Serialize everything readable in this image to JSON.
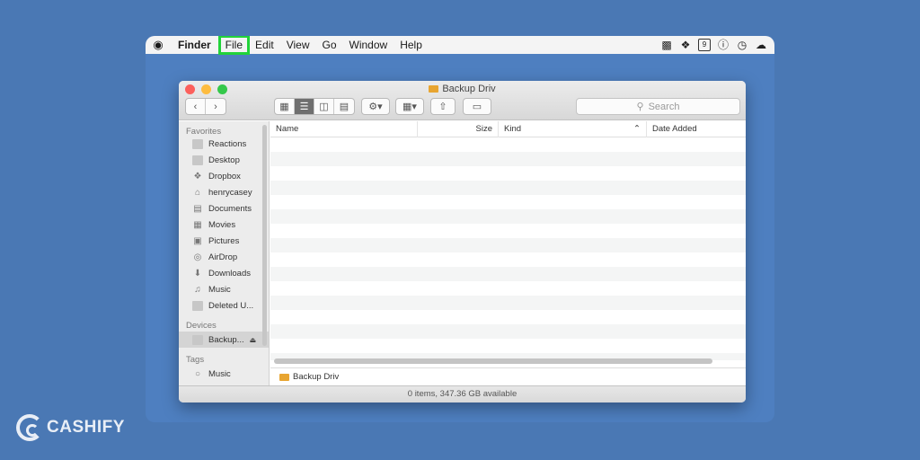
{
  "menubar": {
    "app": "Finder",
    "items": [
      "File",
      "Edit",
      "View",
      "Go",
      "Window",
      "Help"
    ],
    "tray_icons": [
      "script-icon",
      "dropbox-icon",
      "calendar-icon",
      "password-icon",
      "backup-icon",
      "weather-icon"
    ],
    "calendar_day": "9"
  },
  "window": {
    "title": "Backup Driv",
    "search_placeholder": "Search",
    "status": "0 items, 347.36 GB available"
  },
  "sidebar": {
    "favorites_label": "Favorites",
    "favorites": [
      {
        "label": "Reactions",
        "icon": "folder-icon"
      },
      {
        "label": "Desktop",
        "icon": "desktop-icon"
      },
      {
        "label": "Dropbox",
        "icon": "dropbox-icon"
      },
      {
        "label": "henrycasey",
        "icon": "home-icon"
      },
      {
        "label": "Documents",
        "icon": "documents-icon"
      },
      {
        "label": "Movies",
        "icon": "movies-icon"
      },
      {
        "label": "Pictures",
        "icon": "pictures-icon"
      },
      {
        "label": "AirDrop",
        "icon": "airdrop-icon"
      },
      {
        "label": "Downloads",
        "icon": "downloads-icon"
      },
      {
        "label": "Music",
        "icon": "music-icon"
      },
      {
        "label": "Deleted U...",
        "icon": "folder-icon"
      }
    ],
    "devices_label": "Devices",
    "devices": [
      {
        "label": "Backup...",
        "icon": "drive-icon"
      }
    ],
    "tags_label": "Tags",
    "tags": [
      {
        "label": "Music",
        "icon": "tag-circle-icon"
      }
    ]
  },
  "list": {
    "columns": [
      "Name",
      "Size",
      "Kind",
      "Date Added"
    ]
  },
  "pathbar": {
    "label": "Backup Driv"
  },
  "logo": {
    "text": "CASHIFY"
  },
  "colors": {
    "highlight": "#22d33a",
    "background": "#4a78b4"
  }
}
